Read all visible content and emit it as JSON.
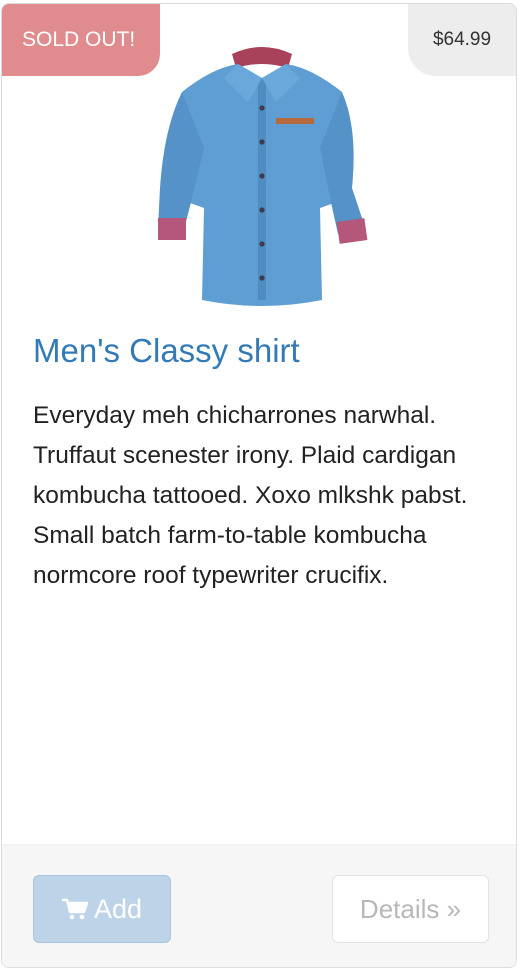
{
  "badges": {
    "sold_out": "SOLD OUT!",
    "price": "$64.99"
  },
  "product": {
    "title": "Men's Classy shirt",
    "description": "Everyday meh chicharrones narwhal. Truffaut scenester irony. Plaid cardigan kombucha tattooed. Xoxo mlkshk pabst. Small batch farm-to-table kombucha normcore roof typewriter crucifix.",
    "image_icon": "denim-shirt-image"
  },
  "actions": {
    "add_label": "Add",
    "add_icon": "shopping-cart-icon",
    "details_label": "Details »"
  },
  "colors": {
    "sold_out_badge": "#e08c8f",
    "price_badge": "#ededed",
    "title": "#337ab7",
    "add_button": "#bcd3e8",
    "footer": "#f6f6f6"
  }
}
